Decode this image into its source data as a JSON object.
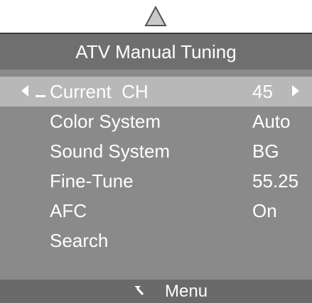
{
  "scroll_indicator": {
    "icon": "triangle-up-icon"
  },
  "menu": {
    "title": "ATV Manual Tuning",
    "items": [
      {
        "label": "Current  CH",
        "value": "45",
        "selected": true
      },
      {
        "label": "Color System",
        "value": "Auto",
        "selected": false
      },
      {
        "label": "Sound System",
        "value": "BG",
        "selected": false
      },
      {
        "label": "Fine-Tune",
        "value": "55.25",
        "selected": false
      },
      {
        "label": "AFC",
        "value": "On",
        "selected": false
      },
      {
        "label": "Search",
        "value": "",
        "selected": false
      }
    ]
  },
  "footer": {
    "icon": "return-arrow-icon",
    "label": "Menu"
  },
  "colors": {
    "panel_bg": "#8a8a8a",
    "title_bg": "#6f6f6f",
    "selected_bg": "#b8b8b8",
    "footer_bg": "#6a6a6a",
    "text": "#ffffff"
  }
}
